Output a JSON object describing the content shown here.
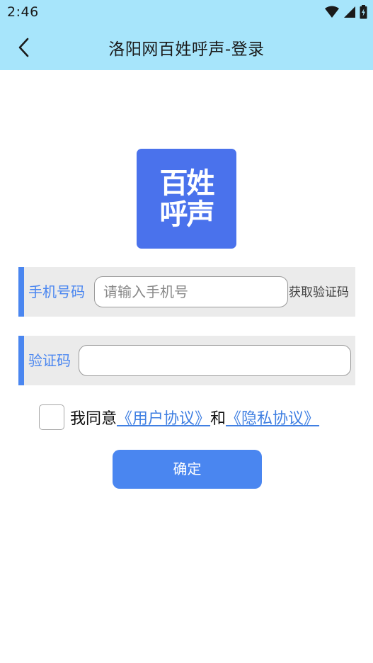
{
  "status_bar": {
    "time": "2:46",
    "icons": [
      "wifi-icon",
      "signal-icon",
      "battery-icon"
    ]
  },
  "header": {
    "title": "洛阳网百姓呼声-登录",
    "back_icon": "chevron-left-icon"
  },
  "logo": {
    "line1": "百姓",
    "line2": "呼声",
    "color": "#4a72ec"
  },
  "form": {
    "phone": {
      "label": "手机号码",
      "placeholder": "请输入手机号",
      "value": "",
      "get_code_label": "获取验证码"
    },
    "code": {
      "label": "验证码",
      "placeholder": "",
      "value": ""
    }
  },
  "agreement": {
    "checked": false,
    "prefix": "我同意",
    "user_link": "《用户协议》",
    "conjunction": "和",
    "privacy_link": "《隐私协议》"
  },
  "confirm_label": "确定",
  "colors": {
    "header_bg": "#a7e5fb",
    "accent": "#4a86f0",
    "link": "#3f7fe2",
    "row_bg": "#ebebeb"
  }
}
